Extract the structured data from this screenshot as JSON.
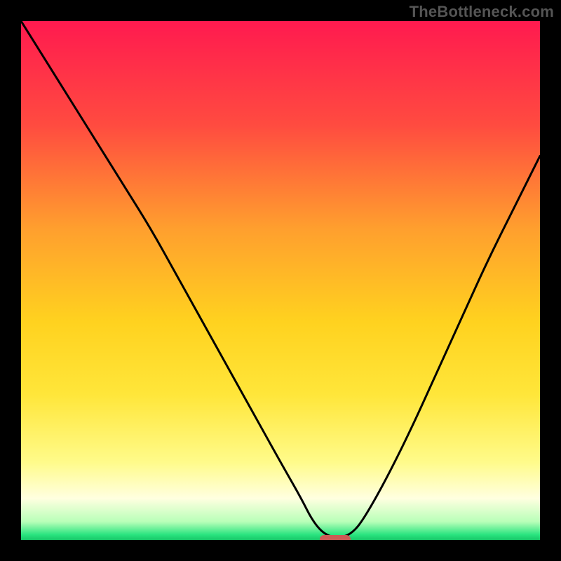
{
  "watermark": "TheBottleneck.com",
  "chart_data": {
    "type": "line",
    "title": "",
    "xlabel": "",
    "ylabel": "",
    "xlim": [
      0,
      100
    ],
    "ylim": [
      0,
      100
    ],
    "grid": false,
    "legend": false,
    "background_gradient": {
      "stops": [
        {
          "offset": 0.0,
          "color": "#ff1a4f"
        },
        {
          "offset": 0.2,
          "color": "#ff4b40"
        },
        {
          "offset": 0.4,
          "color": "#ff9f2e"
        },
        {
          "offset": 0.58,
          "color": "#ffd21f"
        },
        {
          "offset": 0.72,
          "color": "#ffe63a"
        },
        {
          "offset": 0.85,
          "color": "#fffb8a"
        },
        {
          "offset": 0.92,
          "color": "#ffffe0"
        },
        {
          "offset": 0.965,
          "color": "#b8ffb8"
        },
        {
          "offset": 0.99,
          "color": "#29e47f"
        },
        {
          "offset": 1.0,
          "color": "#18c768"
        }
      ]
    },
    "series": [
      {
        "name": "bottleneck-curve",
        "color": "#000000",
        "x": [
          0,
          5,
          10,
          15,
          20,
          25,
          30,
          35,
          40,
          45,
          50,
          54,
          56,
          58,
          60,
          62,
          64,
          66,
          70,
          75,
          80,
          85,
          90,
          95,
          100
        ],
        "y": [
          100,
          92,
          84,
          76,
          68,
          60,
          51,
          42,
          33,
          24,
          15,
          8,
          4,
          1.5,
          0.5,
          0.5,
          1.5,
          4,
          11,
          21,
          32,
          43,
          54,
          64,
          74
        ]
      }
    ],
    "marker": {
      "name": "optimal-range",
      "color": "#cc5b55",
      "x_start": 57.5,
      "x_end": 63.5,
      "y": 0.2
    }
  }
}
